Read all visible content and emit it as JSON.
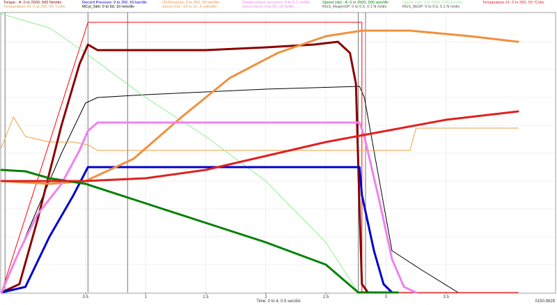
{
  "chart_data": {
    "type": "line",
    "xlabel": "Time: 0 to 4, 0.5 sec/div",
    "xlim": [
      -0.2,
      4.4
    ],
    "ylim": [
      0,
      10
    ],
    "x_ticks": [
      0.5,
      1,
      1.5,
      2,
      2.5,
      3,
      3.5
    ],
    "x_tick_labels": [
      "0.5",
      "1",
      "1.5",
      "2",
      "2.5",
      "3",
      "3.5"
    ],
    "corner_readout": "0150.9829",
    "grid": true,
    "legend_position": "top",
    "cursors": [
      -0.17,
      0.52,
      0.85,
      2.77,
      2.83
    ],
    "series": [
      {
        "name": "Torque - A: 0 to 2500, 500 Nm/div",
        "color": "#8b0000",
        "width": 3,
        "points": [
          [
            -0.2,
            0
          ],
          [
            -0.05,
            0.3
          ],
          [
            0.1,
            2.6
          ],
          [
            0.3,
            6.0
          ],
          [
            0.45,
            8.2
          ],
          [
            0.52,
            8.9
          ],
          [
            0.6,
            8.7
          ],
          [
            1.0,
            8.7
          ],
          [
            1.5,
            8.7
          ],
          [
            2.0,
            8.8
          ],
          [
            2.4,
            8.9
          ],
          [
            2.6,
            9.0
          ],
          [
            2.7,
            8.6
          ],
          [
            2.75,
            7.5
          ],
          [
            2.78,
            3.0
          ],
          [
            2.8,
            0.3
          ],
          [
            2.85,
            0
          ]
        ]
      },
      {
        "name": "Record Pressure: 0 to 250, 50 bar/div",
        "color": "#0000cc",
        "width": 3,
        "points": [
          [
            -0.2,
            0
          ],
          [
            0.0,
            0.2
          ],
          [
            0.2,
            2.0
          ],
          [
            0.4,
            3.5
          ],
          [
            0.52,
            4.5
          ],
          [
            1.0,
            4.5
          ],
          [
            2.0,
            4.5
          ],
          [
            2.78,
            4.5
          ],
          [
            2.8,
            3.5
          ],
          [
            2.9,
            1.5
          ],
          [
            2.98,
            0.3
          ],
          [
            3.05,
            0
          ]
        ]
      },
      {
        "name": "Oil Pressure: 0 to 250, 50 bar/div",
        "color": "#f0903c",
        "width": 3,
        "points": [
          [
            -0.2,
            4.0
          ],
          [
            0.2,
            3.9
          ],
          [
            0.5,
            4.0
          ],
          [
            0.9,
            4.8
          ],
          [
            1.3,
            6.3
          ],
          [
            1.7,
            7.7
          ],
          [
            2.1,
            8.6
          ],
          [
            2.5,
            9.2
          ],
          [
            2.8,
            9.4
          ],
          [
            3.2,
            9.4
          ],
          [
            3.7,
            9.2
          ],
          [
            4.1,
            9.0
          ]
        ]
      },
      {
        "name": "Displacement accuracy: 0 to 0.1 cm/div",
        "color": "#ee82ee",
        "width": 3,
        "points": [
          [
            -0.2,
            0
          ],
          [
            -0.05,
            1.5
          ],
          [
            0.1,
            2.8
          ],
          [
            0.3,
            3.9
          ],
          [
            0.45,
            5.1
          ],
          [
            0.52,
            5.8
          ],
          [
            0.6,
            6.1
          ],
          [
            1.5,
            6.1
          ],
          [
            2.78,
            6.1
          ],
          [
            2.82,
            5.6
          ],
          [
            2.95,
            3.2
          ],
          [
            3.05,
            1.2
          ],
          [
            3.15,
            0.2
          ],
          [
            3.25,
            0
          ]
        ]
      },
      {
        "name": "Speed (ob) - A: 0 to 2500, 500 rpm/div",
        "color": "#008000",
        "width": 3,
        "points": [
          [
            -0.2,
            4.4
          ],
          [
            0.0,
            4.35
          ],
          [
            0.2,
            4.1
          ],
          [
            0.5,
            3.9
          ],
          [
            1.0,
            3.2
          ],
          [
            1.5,
            2.5
          ],
          [
            2.0,
            1.8
          ],
          [
            2.5,
            1.0
          ],
          [
            2.77,
            0
          ],
          [
            3.1,
            0
          ]
        ]
      },
      {
        "name": "Temperature #1: 0 to 250, 50 °C/div",
        "color": "#e02020",
        "width": 3,
        "points": [
          [
            -0.2,
            4.0
          ],
          [
            0.5,
            4.0
          ],
          [
            1.0,
            4.1
          ],
          [
            1.5,
            4.4
          ],
          [
            2.0,
            4.9
          ],
          [
            2.5,
            5.4
          ],
          [
            3.0,
            5.8
          ],
          [
            3.5,
            6.2
          ],
          [
            4.1,
            6.5
          ]
        ]
      },
      {
        "name": "MCyl_Strk: 0 to 50, 10 mm/div",
        "color": "#000000",
        "width": 1,
        "points": [
          [
            -0.2,
            0
          ],
          [
            -0.05,
            1.5
          ],
          [
            0.1,
            3.0
          ],
          [
            0.3,
            5.0
          ],
          [
            0.5,
            6.8
          ],
          [
            0.6,
            7.0
          ],
          [
            1.0,
            7.1
          ],
          [
            1.5,
            7.2
          ],
          [
            2.0,
            7.3
          ],
          [
            2.78,
            7.4
          ],
          [
            2.82,
            7.0
          ],
          [
            3.05,
            1.5
          ],
          [
            3.3,
            0.8
          ],
          [
            3.6,
            0
          ],
          [
            4.1,
            0
          ]
        ]
      },
      {
        "name": "Servo Out: -10 to 10, 4 volts/div",
        "color": "#ff0000",
        "width": 1,
        "points": [
          [
            -0.2,
            0
          ],
          [
            0.52,
            9.7
          ],
          [
            2.8,
            9.7
          ],
          [
            2.8,
            0
          ],
          [
            4.1,
            0
          ]
        ]
      },
      {
        "name": "Temperature #2: 0 to 250, 50 °C/div",
        "color": "#e8a040",
        "width": 1,
        "points": [
          [
            -0.2,
            5.2
          ],
          [
            -0.1,
            6.3
          ],
          [
            0.0,
            5.6
          ],
          [
            0.2,
            5.4
          ],
          [
            0.4,
            5.4
          ],
          [
            0.52,
            5.3
          ],
          [
            0.6,
            5.1
          ],
          [
            1.0,
            5.1
          ],
          [
            2.0,
            5.1
          ],
          [
            2.8,
            5.1
          ],
          [
            3.2,
            5.1
          ],
          [
            3.25,
            5.9
          ],
          [
            3.7,
            5.9
          ],
          [
            4.1,
            5.9
          ]
        ]
      },
      {
        "name": "Servo Dec2: 0 to 50, 10 %/div",
        "color": "#90ee90",
        "width": 1,
        "points": [
          [
            -0.2,
            10.0
          ],
          [
            0.2,
            9.5
          ],
          [
            0.5,
            8.6
          ],
          [
            1.0,
            7.0
          ],
          [
            1.5,
            5.6
          ],
          [
            2.0,
            4.0
          ],
          [
            2.5,
            1.8
          ],
          [
            2.77,
            0
          ]
        ]
      }
    ]
  },
  "legend": [
    {
      "text": "Torque - A: 0 to 2500, 500 Nm/div",
      "color": "#8b0000"
    },
    {
      "text": "Temperature #2: 0 to 250, 50 °C/div",
      "color": "#e8a040"
    },
    {
      "text": "Record Pressure: 0 to 250, 50 bar/div",
      "color": "#0000cc"
    },
    {
      "text": "MCyl_Strk: 0 to 50, 10 mm/div",
      "color": "#000000"
    },
    {
      "text": "Oil Pressure: 0 to 250, 50 bar/div",
      "color": "#f0903c"
    },
    {
      "text": "Servo Out: -10 to 10, 4 volts/div",
      "color": "#e8a040"
    },
    {
      "text": "Displacement accuracy: 0 to 0.1 cm/div",
      "color": "#ee82ee"
    },
    {
      "text": "Servo Dec2: 0 to 50, 10 %/div",
      "color": "#ee82ee"
    },
    {
      "text": "Speed (ob) - A: 0 to 2500, 500 rpm/div",
      "color": "#008000"
    },
    {
      "text": "RGS_RegenSP: 0 to 0.5, 0.1 N m/div",
      "color": "#555555"
    },
    {
      "text": "Speed (ob): 0 to 2500, 500 rpm/div",
      "color": "#90ee90"
    },
    {
      "text": "RGS_BkSP: 0 to 0.5, 0.1 N m/div",
      "color": "#555555"
    },
    {
      "text": "Temperature #1: 0 to 250, 50 °C/div",
      "color": "#e02020"
    }
  ]
}
